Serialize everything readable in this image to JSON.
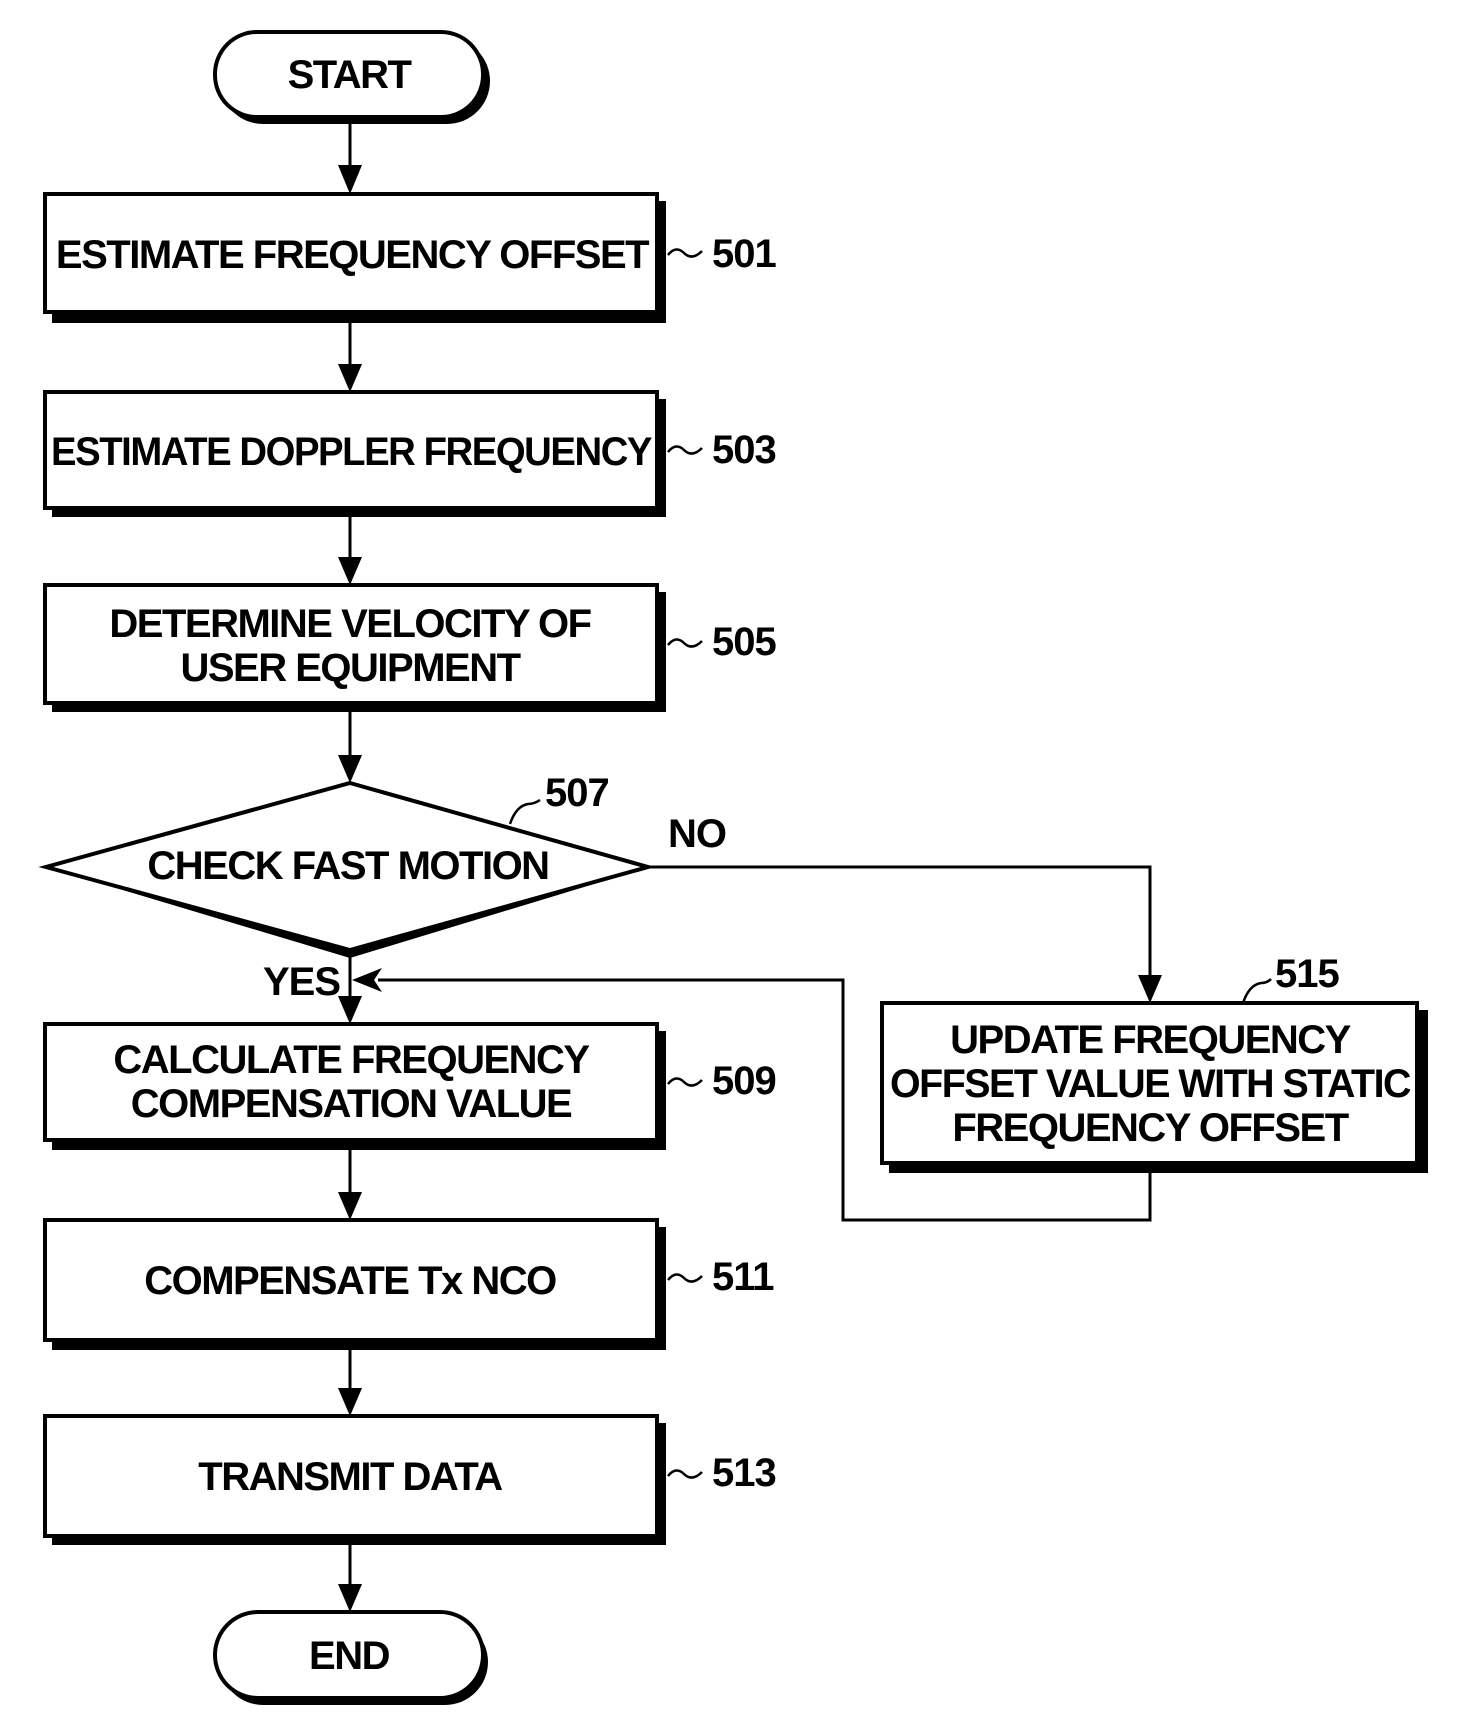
{
  "diagram": {
    "type": "flowchart",
    "terminals": {
      "start": "START",
      "end": "END"
    },
    "steps": [
      {
        "id": "501",
        "lines": [
          "ESTIMATE FREQUENCY OFFSET"
        ]
      },
      {
        "id": "503",
        "lines": [
          "ESTIMATE DOPPLER FREQUENCY"
        ]
      },
      {
        "id": "505",
        "lines": [
          "DETERMINE VELOCITY OF",
          "USER EQUIPMENT"
        ]
      },
      {
        "id": "509",
        "lines": [
          "CALCULATE FREQUENCY",
          "COMPENSATION VALUE"
        ]
      },
      {
        "id": "511",
        "lines": [
          "COMPENSATE Tx NCO"
        ]
      },
      {
        "id": "513",
        "lines": [
          "TRANSMIT DATA"
        ]
      },
      {
        "id": "515",
        "lines": [
          "UPDATE FREQUENCY",
          "OFFSET VALUE WITH STATIC",
          "FREQUENCY OFFSET"
        ]
      }
    ],
    "decision": {
      "id": "507",
      "label": "CHECK FAST MOTION",
      "yes_label": "YES",
      "no_label": "NO"
    },
    "flow": [
      [
        "START",
        "501"
      ],
      [
        "501",
        "503"
      ],
      [
        "503",
        "505"
      ],
      [
        "505",
        "507"
      ],
      [
        "507:YES",
        "509"
      ],
      [
        "507:NO",
        "515"
      ],
      [
        "515",
        "509"
      ],
      [
        "509",
        "511"
      ],
      [
        "511",
        "513"
      ],
      [
        "513",
        "END"
      ]
    ]
  }
}
